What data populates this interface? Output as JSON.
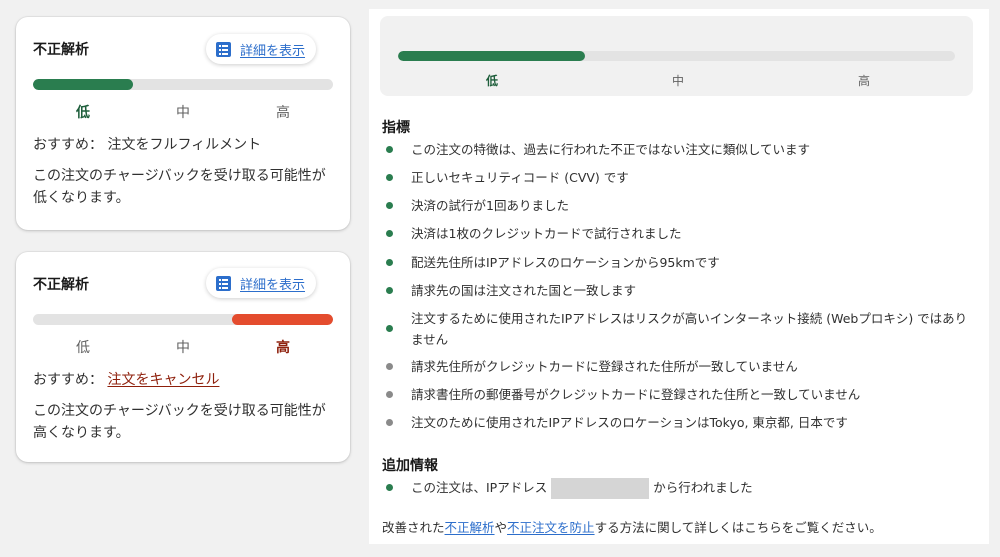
{
  "card_low": {
    "title": "不正解析",
    "detail_label": "詳細を表示",
    "risk_level": "低",
    "levels": [
      "低",
      "中",
      "高"
    ],
    "rec_prefix": "おすすめ：",
    "recommendation": "注文をフルフィルメント",
    "description": "この注文のチャージバックを受け取る可能性が低くなります。",
    "accent_color": "#2a7d4f"
  },
  "card_high": {
    "title": "不正解析",
    "detail_label": "詳細を表示",
    "risk_level": "高",
    "levels": [
      "低",
      "中",
      "高"
    ],
    "rec_prefix": "おすすめ：",
    "recommendation": "注文をキャンセル",
    "description": "この注文のチャージバックを受け取る可能性が高くなります。",
    "accent_color": "#e44c2e"
  },
  "detail_panel": {
    "meter": {
      "levels": [
        "低",
        "中",
        "高"
      ],
      "active": "低",
      "accent_color": "#2a7d4f"
    },
    "indicators_title": "指標",
    "indicators": [
      {
        "text": "この注文の特徴は、過去に行われた不正ではない注文に類似しています",
        "status": "positive"
      },
      {
        "text": "正しいセキュリティコード (CVV) です",
        "status": "positive"
      },
      {
        "text": "決済の試行が1回ありました",
        "status": "positive"
      },
      {
        "text": "決済は1枚のクレジットカードで試行されました",
        "status": "positive"
      },
      {
        "text": "配送先住所はIPアドレスのロケーションから95kmです",
        "status": "positive"
      },
      {
        "text": "請求先の国は注文された国と一致します",
        "status": "positive"
      },
      {
        "text": "注文するために使用されたIPアドレスはリスクが高いインターネット接続 (Webプロキシ) ではありません",
        "status": "positive"
      },
      {
        "text": "請求先住所がクレジットカードに登録された住所が一致していません",
        "status": "neutral"
      },
      {
        "text": "請求書住所の郵便番号がクレジットカードに登録された住所と一致していません",
        "status": "neutral"
      },
      {
        "text": "注文のために使用されたIPアドレスのロケーションはTokyo, 東京都, 日本です",
        "status": "neutral"
      }
    ],
    "additional_title": "追加情報",
    "additional_prefix": "この注文は、IPアドレス",
    "additional_suffix": "から行われました",
    "footer_prefix": "改善された",
    "footer_link1": "不正解析",
    "footer_mid": "や",
    "footer_link2": "不正注文を防止",
    "footer_suffix": "する方法に関して詳しくはこちらをご覧ください。",
    "colors": {
      "positive": "#2a7d4f",
      "neutral": "#8a8a8a"
    }
  }
}
